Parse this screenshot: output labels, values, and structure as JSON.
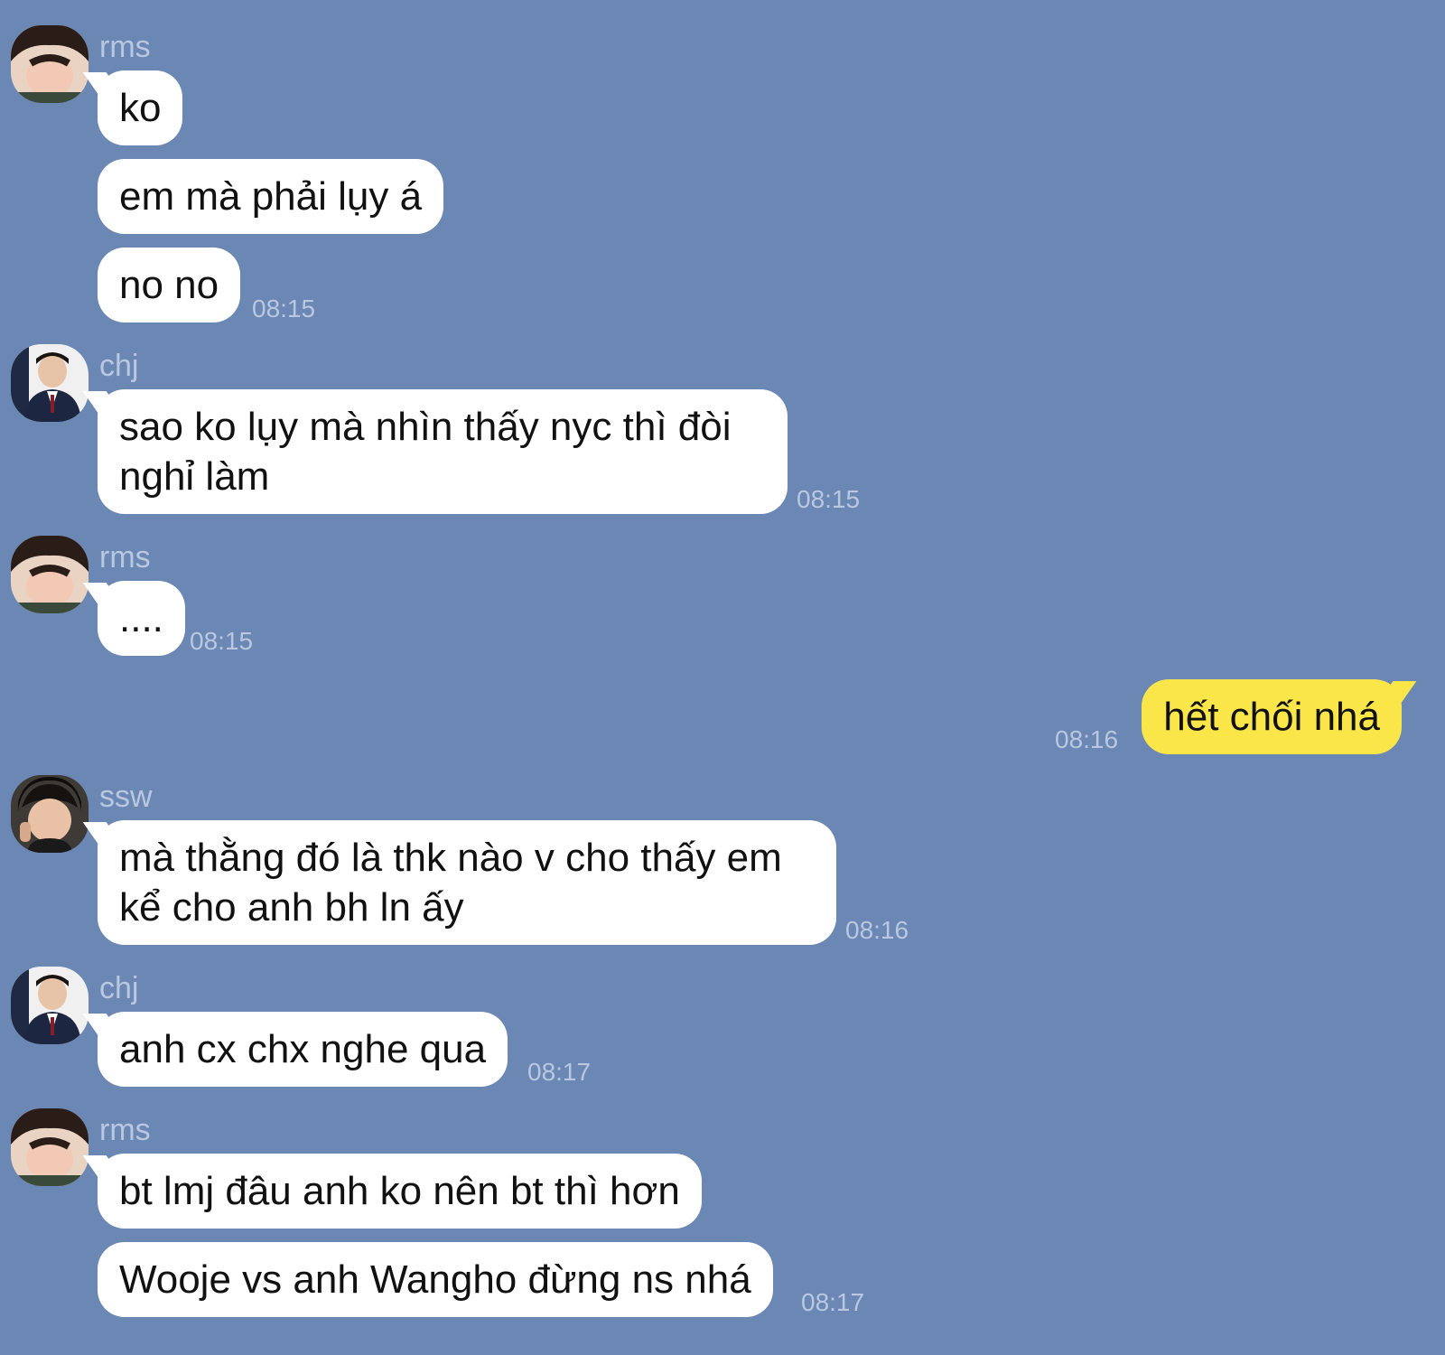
{
  "messages": [
    {
      "sender": "rms",
      "avatar": "profile-photo-rms",
      "bubbles": [
        "ko",
        "em mà phải lụy á",
        "no no"
      ],
      "time": "08:15"
    },
    {
      "sender": "chj",
      "avatar": "profile-photo-chj",
      "bubbles": [
        "sao ko lụy mà nhìn thấy nyc thì đòi nghỉ làm"
      ],
      "time": "08:15"
    },
    {
      "sender": "rms",
      "avatar": "profile-photo-rms",
      "bubbles": [
        "...."
      ],
      "time": "08:15"
    },
    {
      "sender": "me",
      "outgoing": true,
      "bubbles": [
        "hết chối nhá"
      ],
      "time": "08:16"
    },
    {
      "sender": "ssw",
      "avatar": "profile-photo-ssw",
      "bubbles": [
        "mà thằng đó là thk nào v cho thấy em kể cho anh bh ln ấy"
      ],
      "time": "08:16"
    },
    {
      "sender": "chj",
      "avatar": "profile-photo-chj",
      "bubbles": [
        "anh cx chx nghe qua"
      ],
      "time": "08:17"
    },
    {
      "sender": "rms",
      "avatar": "profile-photo-rms",
      "bubbles": [
        "bt lmj đâu anh ko nên bt thì hơn",
        "Wooje vs anh Wangho đừng ns nhá"
      ],
      "time": "08:17"
    }
  ],
  "colors": {
    "background": "#6b87b3",
    "incoming_bubble": "#ffffff",
    "outgoing_bubble": "#fbe64a",
    "meta_text": "#b9c8e0"
  }
}
